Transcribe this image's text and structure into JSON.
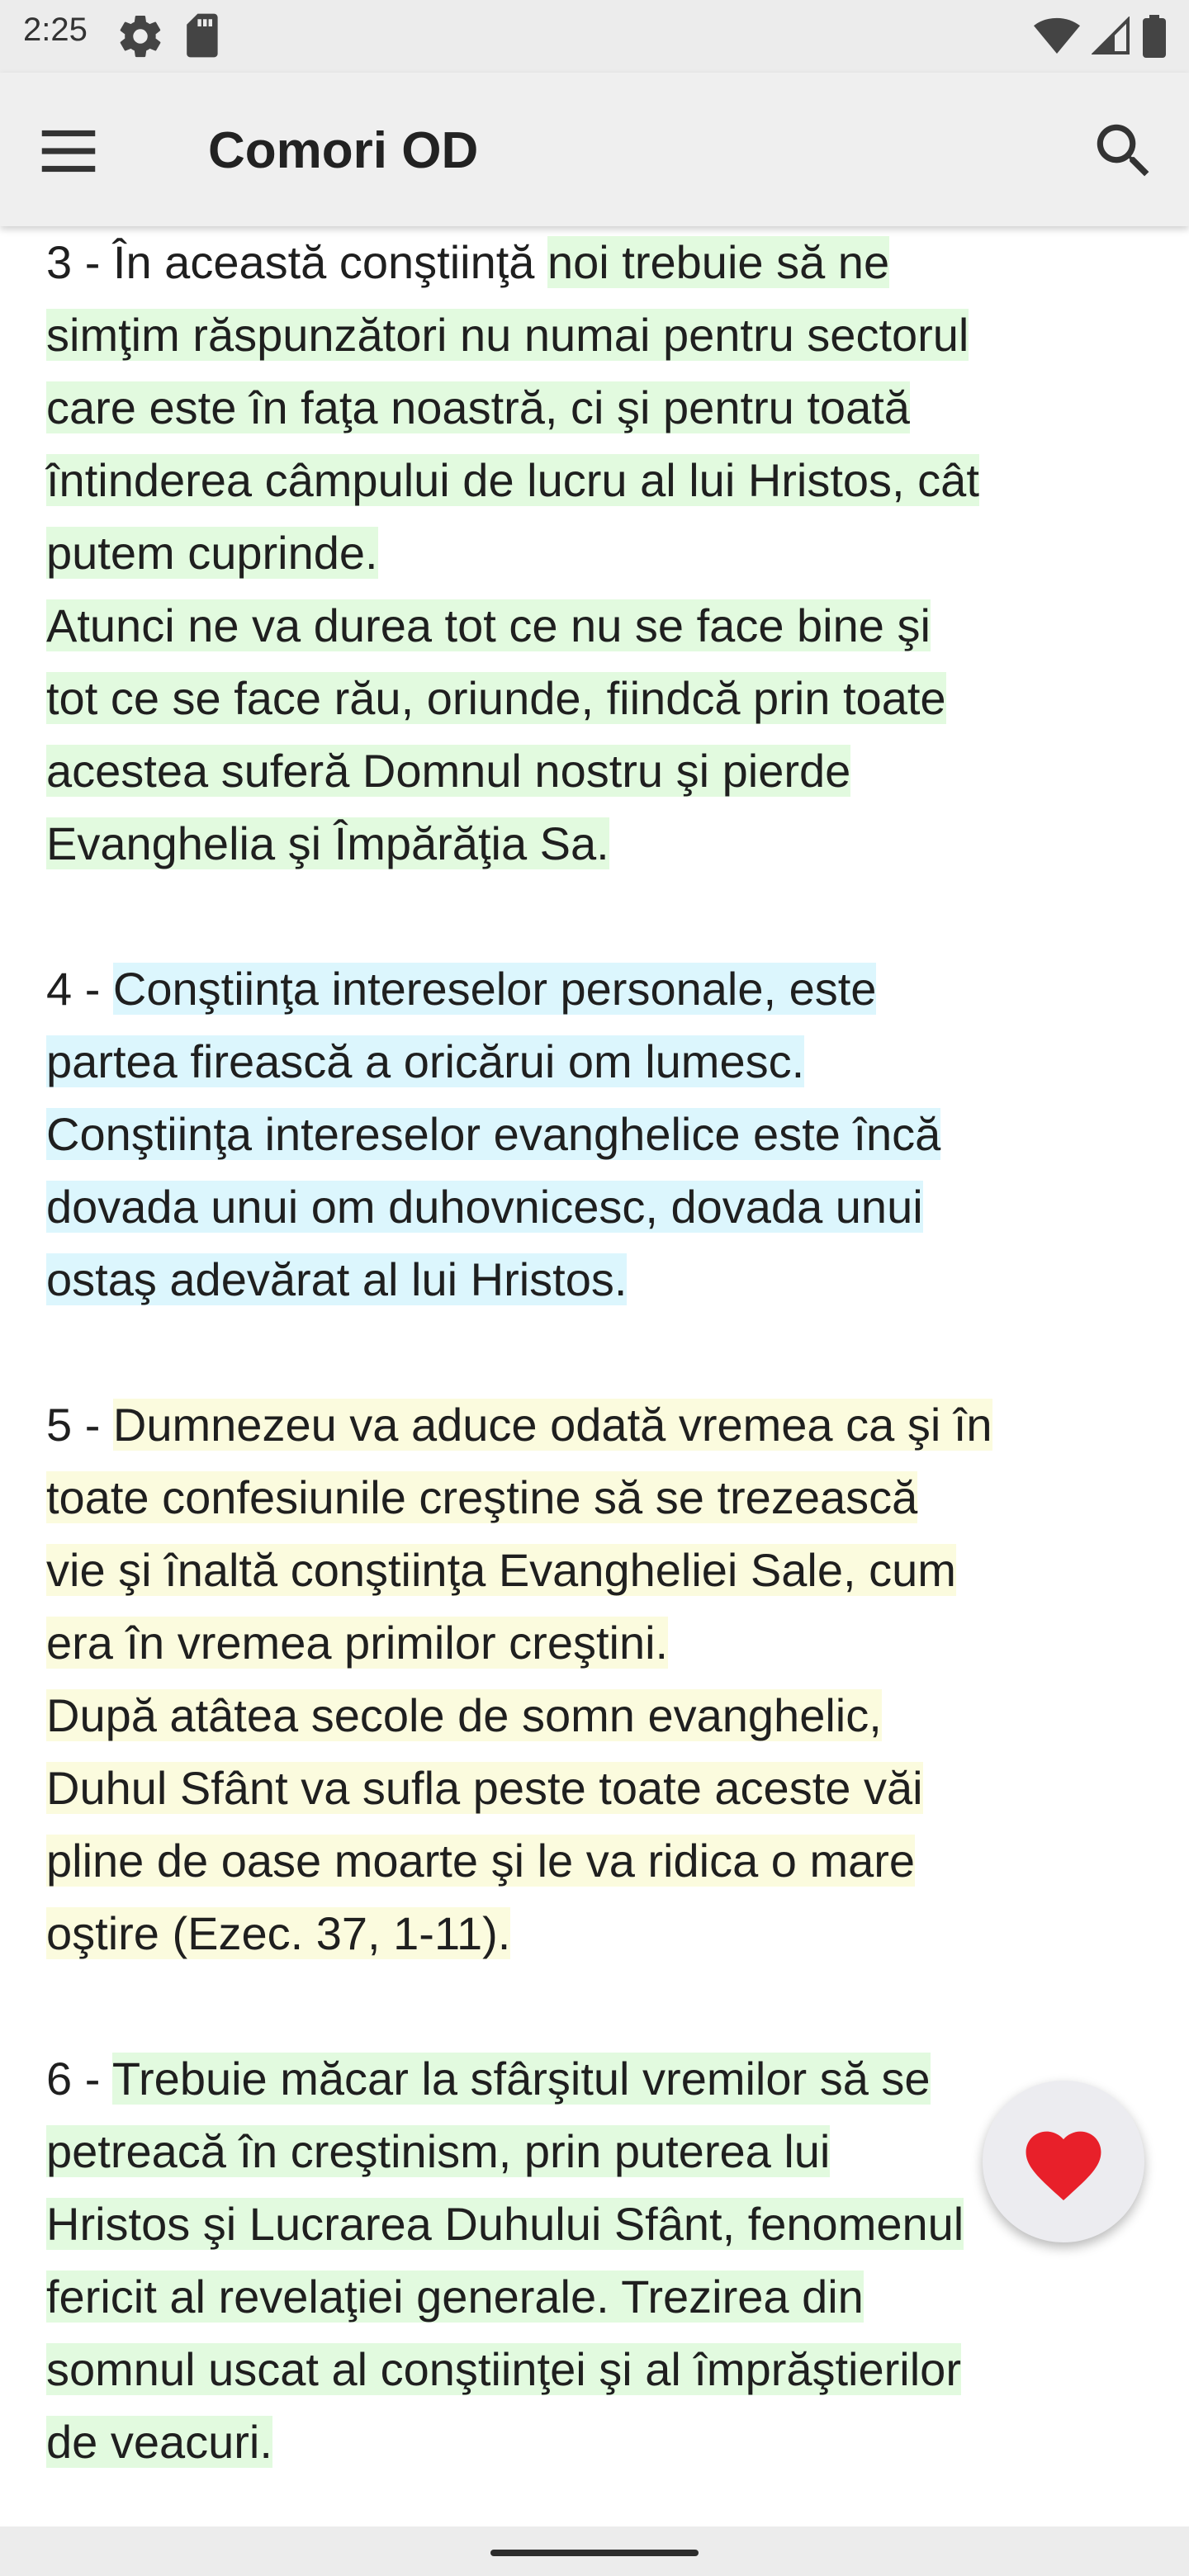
{
  "status_bar": {
    "time": "2:25",
    "icons": [
      "settings-icon",
      "sd-card-icon",
      "wifi-icon",
      "signal-icon",
      "battery-icon"
    ]
  },
  "app_bar": {
    "title": "Comori OD",
    "menu_icon": "hamburger-menu-icon",
    "search_icon": "search-icon"
  },
  "paragraphs": [
    {
      "lines": [
        [
          {
            "text": "3 - În această conştiinţă ",
            "highlight": "none"
          },
          {
            "text": "noi trebuie să ne",
            "highlight": "green"
          }
        ],
        [
          {
            "text": "simţim răspunzători nu numai pentru sectorul",
            "highlight": "green"
          }
        ],
        [
          {
            "text": "care este în faţa noastră, ci şi pentru toată",
            "highlight": "green"
          }
        ],
        [
          {
            "text": "întinderea câmpului de lucru al lui Hristos, cât",
            "highlight": "green"
          }
        ],
        [
          {
            "text": "putem cuprinde.",
            "highlight": "green"
          }
        ],
        [
          {
            "text": "Atunci ne va durea tot ce nu se face bine şi",
            "highlight": "green"
          }
        ],
        [
          {
            "text": "tot ce se face rău, oriunde, fiindcă prin toate",
            "highlight": "green"
          }
        ],
        [
          {
            "text": "acestea suferă Domnul nostru şi pierde",
            "highlight": "green"
          }
        ],
        [
          {
            "text": "Evanghelia şi Împărăţia Sa.",
            "highlight": "green"
          }
        ]
      ]
    },
    {
      "lines": [
        [
          {
            "text": "4 - ",
            "highlight": "none"
          },
          {
            "text": "Conştiinţa intereselor personale, este",
            "highlight": "blue"
          }
        ],
        [
          {
            "text": "partea firească a oricărui om lumesc.",
            "highlight": "blue"
          }
        ],
        [
          {
            "text": "Conştiinţa intereselor evanghelice este încă",
            "highlight": "blue"
          }
        ],
        [
          {
            "text": "dovada unui om duhovnicesc, dovada unui",
            "highlight": "blue"
          }
        ],
        [
          {
            "text": "ostaş adevărat al lui Hristos.",
            "highlight": "blue"
          }
        ]
      ]
    },
    {
      "lines": [
        [
          {
            "text": "5 - ",
            "highlight": "none"
          },
          {
            "text": "Dumnezeu va aduce odată vremea ca şi în",
            "highlight": "yellow"
          }
        ],
        [
          {
            "text": "toate confesiunile creştine să se trezească",
            "highlight": "yellow"
          }
        ],
        [
          {
            "text": "vie şi înaltă conştiinţa Evangheliei Sale, cum",
            "highlight": "yellow"
          }
        ],
        [
          {
            "text": "era în vremea primilor creştini.",
            "highlight": "yellow"
          }
        ],
        [
          {
            "text": "După atâtea secole de somn evanghelic,",
            "highlight": "yellow"
          }
        ],
        [
          {
            "text": "Duhul Sfânt va sufla peste toate aceste văi",
            "highlight": "yellow"
          }
        ],
        [
          {
            "text": "pline de oase moarte şi le va ridica o mare",
            "highlight": "yellow"
          }
        ],
        [
          {
            "text": "oştire (Ezec. 37, 1-11).",
            "highlight": "yellow"
          }
        ]
      ]
    },
    {
      "lines": [
        [
          {
            "text": "6 - ",
            "highlight": "none"
          },
          {
            "text": "Trebuie măcar la sfârşitul vremilor să se",
            "highlight": "green"
          }
        ],
        [
          {
            "text": "petreacă în creştinism, prin puterea lui",
            "highlight": "green"
          }
        ],
        [
          {
            "text": "Hristos şi Lucrarea Duhului Sfânt, fenomenul",
            "highlight": "green"
          }
        ],
        [
          {
            "text": "fericit al revelaţiei generale. Trezirea din",
            "highlight": "green"
          }
        ],
        [
          {
            "text": "somnul uscat al conştiinţei şi al împrăştierilor",
            "highlight": "green"
          }
        ],
        [
          {
            "text": "de veacuri.",
            "highlight": "green"
          }
        ]
      ]
    }
  ],
  "fab": {
    "icon": "heart-icon",
    "color": "#e8202a"
  },
  "colors": {
    "highlight_green": "#e2fadf",
    "highlight_blue": "#dcf6fd",
    "highlight_yellow": "#fbfbde",
    "app_bar": "#efefef"
  }
}
